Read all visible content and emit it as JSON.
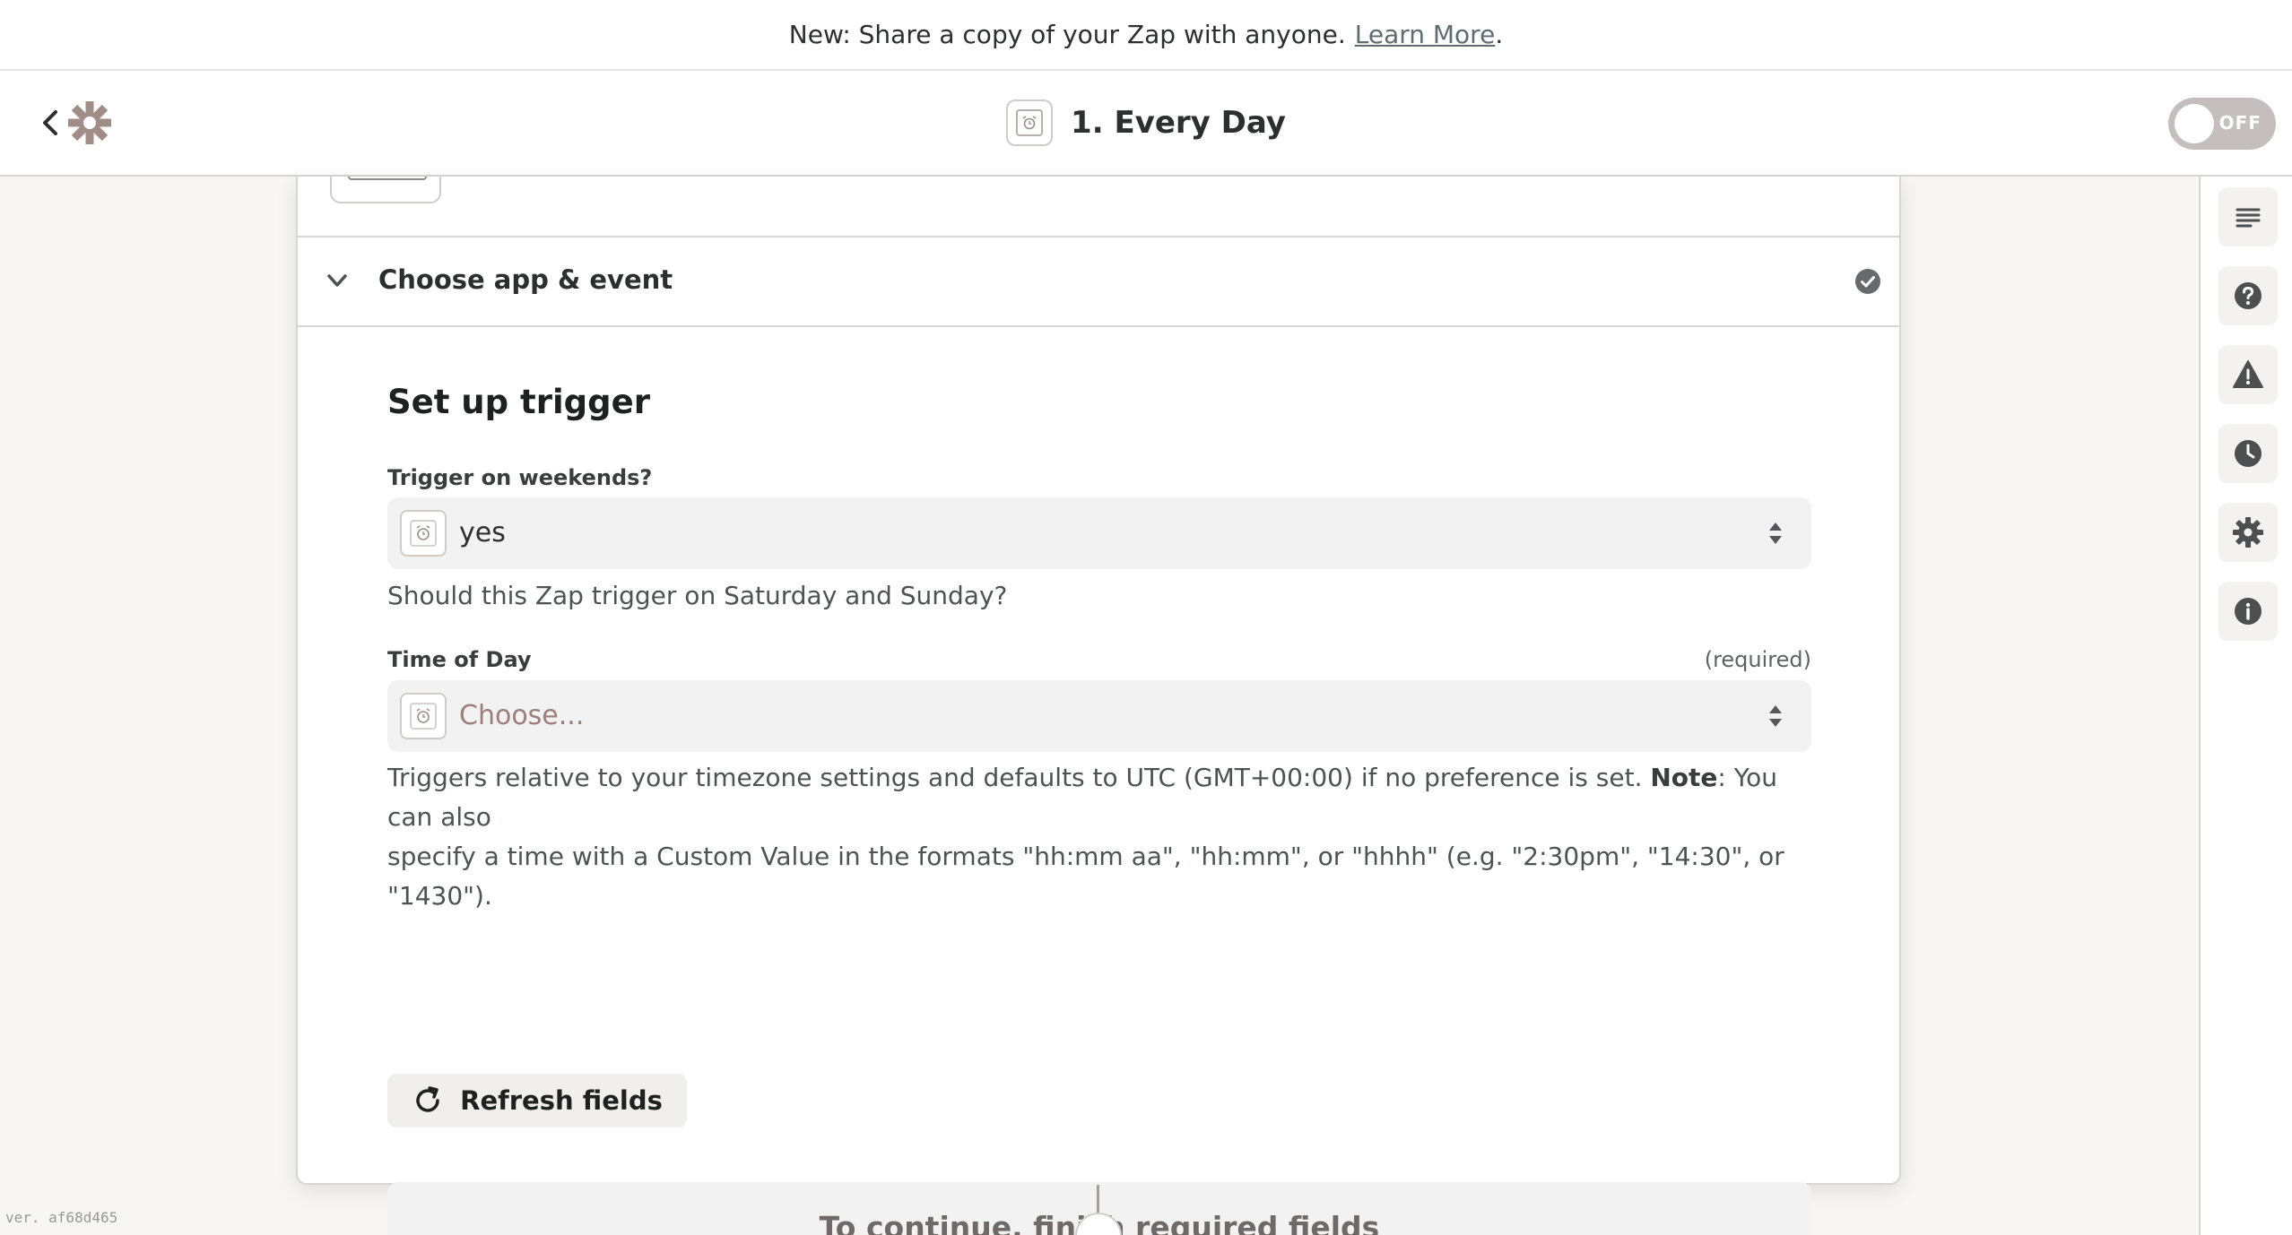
{
  "banner": {
    "text": "New: Share a copy of your Zap with anyone.",
    "link": "Learn More",
    "suffix": "."
  },
  "header": {
    "title": "1. Every Day",
    "toggle_label": "OFF",
    "toggle_state": "off"
  },
  "section": {
    "label": "Choose app & event",
    "status": "complete"
  },
  "form": {
    "title": "Set up trigger",
    "weekends": {
      "label": "Trigger on weekends?",
      "value": "yes",
      "help": "Should this Zap trigger on Saturday and Sunday?"
    },
    "time_of_day": {
      "label": "Time of Day",
      "required": "(required)",
      "placeholder": "Choose...",
      "help_line1_a": "Triggers relative to your timezone settings and defaults to UTC (GMT+00:00) if no preference is set. ",
      "help_note": "Note",
      "help_line1_b": ": You can also",
      "help_line2": "specify a time with a Custom Value in the formats \"hh:mm aa\", \"hh:mm\", or \"hhhh\" (e.g. \"2:30pm\", \"14:30\", or \"1430\")."
    },
    "refresh_label": "Refresh fields",
    "continue_label": "To continue, finish required fields"
  },
  "version": "ver. af68d465",
  "colors": {
    "brand": "#ff4f00",
    "logo_muted": "#a08d88",
    "placeholder": "#9c7f7b",
    "toggle_off": "#c4bfbc"
  }
}
